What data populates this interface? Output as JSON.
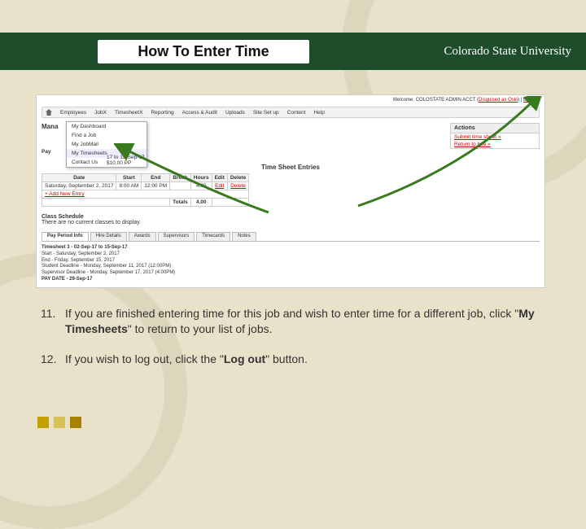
{
  "header": {
    "title": "How To Enter Time",
    "logo": "Colorado State University"
  },
  "shot": {
    "welcome_prefix": "Welcome, COLOSTATE ADMIN ACCT (",
    "disguised": "Disguised as Oski",
    "welcome_suffix": ")  |  ",
    "logout": "Log out",
    "nav": {
      "employees": "Employees",
      "jobx": "JobX",
      "timesheetx": "TimesheetX",
      "reporting": "Reporting",
      "access": "Access & Audit",
      "uploads": "Uploads",
      "siteset": "Site Set up",
      "content": "Content",
      "help": "Help"
    },
    "mana": "Mana",
    "dropdown": {
      "dash": "My Dashboard",
      "find": "Find a Job",
      "jobmail": "My JobMail",
      "ts": "My Timesheets",
      "contact": "Contact Us"
    },
    "actions": {
      "title": "Actions",
      "submit": "Submit time sheet »",
      "return": "Return to hire »"
    },
    "pay": {
      "label": "Pay",
      "range": "17 to 15-Sep-17",
      "rate": "$10.00 PP"
    },
    "tse": {
      "title": "Time Sheet Entries",
      "cols": {
        "date": "Date",
        "start": "Start",
        "end": "End",
        "break": "Break",
        "hours": "Hours",
        "edit": "Edit",
        "delete": "Delete"
      },
      "row": {
        "date": "Saturday, September 2, 2017",
        "start": "8:00 AM",
        "end": "12:00 PM",
        "break": "",
        "hours": "4.00",
        "edit": "Edit",
        "delete": "Delete"
      },
      "add": "+ Add New Entry",
      "totals": "Totals",
      "thours": "4.00"
    },
    "cs": {
      "title": "Class Schedule",
      "body": "There are no current classes to display."
    },
    "tabs": {
      "pp": "Pay Period Info",
      "hire": "Hire Details",
      "awards": "Awards",
      "sup": "Supervisors",
      "tc": "Timecards",
      "notes": "Notes"
    },
    "ppinfo": {
      "l1b": "Timesheet 3 - 02-Sep-17 to 15-Sep-17",
      "l2": "Start - Saturday, September 2, 2017",
      "l3": "End - Friday, September 15, 2017",
      "l4": "Student Deadline - Monday, September 11, 2017 (12:00PM)",
      "l5": "Supervisor Deadline - Monday, September 17, 2017 (4:00PM)",
      "l6": "PAY DATE - 29-Sep-17"
    }
  },
  "instructions": {
    "i11": {
      "num": "11.",
      "pre": "If you are finished entering time for this job and wish to enter time for a different job, click \"",
      "bold": "My Timesheets",
      "post": "\" to return to your list of jobs."
    },
    "i12": {
      "num": "12.",
      "pre": "If you wish to log out, click the \"",
      "bold": "Log out",
      "post": "\" button."
    }
  },
  "colors": {
    "sq1": "#c2a000",
    "sq2": "#d9c15a",
    "sq3": "#a68200"
  }
}
